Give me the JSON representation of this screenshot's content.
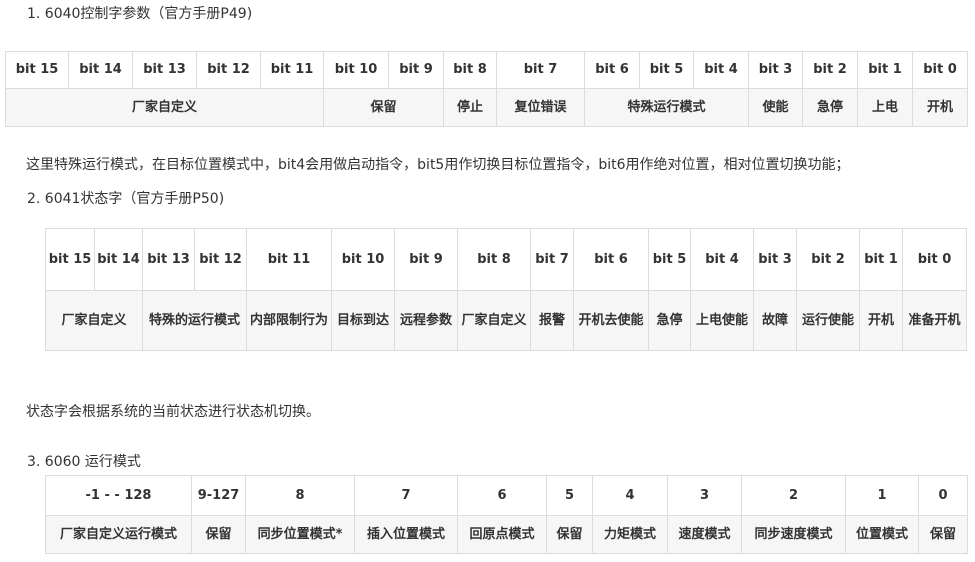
{
  "section1": {
    "heading": "1. 6040控制字参数（官方手册P49)",
    "header": [
      "bit 15",
      "bit 14",
      "bit 13",
      "bit 12",
      "bit 11",
      "bit 10",
      "bit 9",
      "bit 8",
      "bit 7",
      "bit 6",
      "bit 5",
      "bit 4",
      "bit 3",
      "bit 2",
      "bit 1",
      "bit 0"
    ],
    "body": [
      "厂家自定义",
      "保留",
      "停止",
      "复位错误",
      "特殊运行模式",
      "使能",
      "急停",
      "上电",
      "开机"
    ],
    "note": "这里特殊运行模式，在目标位置模式中，bit4会用做启动指令，bit5用作切换目标位置指令，bit6用作绝对位置，相对位置切换功能；"
  },
  "section2": {
    "heading": "2. 6041状态字（官方手册P50)",
    "header": [
      "bit 15",
      "bit 14",
      "bit 13",
      "bit 12",
      "bit 11",
      "bit 10",
      "bit 9",
      "bit 8",
      "bit 7",
      "bit 6",
      "bit 5",
      "bit 4",
      "bit 3",
      "bit 2",
      "bit 1",
      "bit 0"
    ],
    "body": [
      "厂家自定义",
      "特殊的运行模式",
      "内部限制行为",
      "目标到达",
      "远程参数",
      "厂家自定义",
      "报警",
      "开机去使能",
      "急停",
      "上电使能",
      "故障",
      "运行使能",
      "开机",
      "准备开机"
    ],
    "note": "状态字会根据系统的当前状态进行状态机切换。"
  },
  "section3": {
    "heading": "3. 6060 运行模式",
    "header": [
      "-1 - - 128",
      "9-127",
      "8",
      "7",
      "6",
      "5",
      "4",
      "3",
      "2",
      "1",
      "0"
    ],
    "body": [
      "厂家自定义运行模式",
      "保留",
      "同步位置模式*",
      "插入位置模式",
      "回原点模式",
      "保留",
      "力矩模式",
      "速度模式",
      "同步速度模式",
      "位置模式",
      "保留"
    ]
  }
}
